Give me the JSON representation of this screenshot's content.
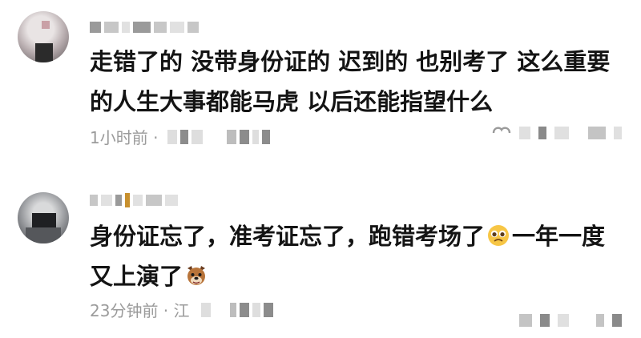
{
  "comments": [
    {
      "text": "走错了的 没带身份证的 迟到的 也别考了 这么重要的人生大事都能马虎 以后还能指望什么",
      "time": "1小时前 ·"
    },
    {
      "text_before_emoji1": "身份证忘了，准考证忘了，跑错考场了",
      "text_after_emoji1": "一年一度又上演了",
      "time": "23分钟前 · 江",
      "emoji1": "pleading-face-icon",
      "emoji2": "dog-face-icon"
    }
  ]
}
